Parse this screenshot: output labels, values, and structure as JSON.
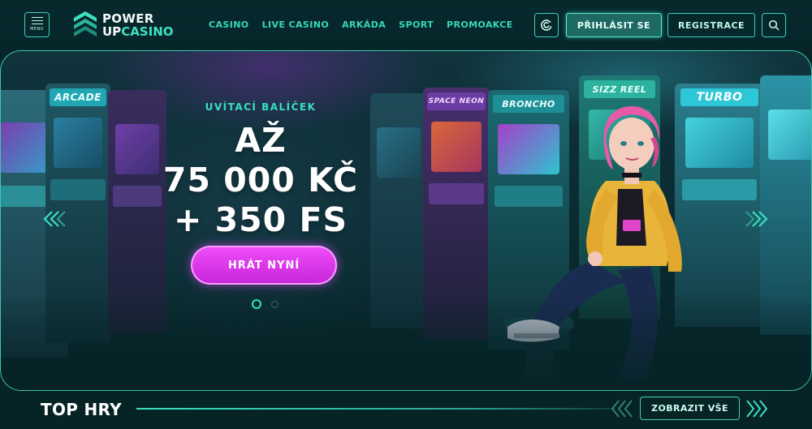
{
  "header": {
    "menu_label": "MENU",
    "logo": {
      "line1": "POWER",
      "line2_a": "UP",
      "line2_b": "CASINO"
    },
    "nav": [
      "CASINO",
      "LIVE CASINO",
      "ARKÁDA",
      "SPORT",
      "PROMOAKCE"
    ],
    "login_label": "PŘIHLÁSIT SE",
    "register_label": "REGISTRACE"
  },
  "hero": {
    "subtitle": "UVÍTACÍ BALÍČEK",
    "title_line1": "AŽ",
    "title_line2": "75 000 KČ",
    "title_line3": "+ 350 FS",
    "cta_label": "HRÁT NYNÍ",
    "slides_total": 2,
    "active_slide": 1,
    "cabinet_marquees": [
      "ARCADE",
      "SPACE NEON",
      "BRONCHO",
      "SIZZ REEL",
      "TURBO"
    ]
  },
  "top_games": {
    "title": "TOP HRY",
    "show_all_label": "ZOBRAZIT VŠE"
  },
  "colors": {
    "background": "#062326",
    "accent": "#38e0c0",
    "cta": "#e43cf0"
  }
}
